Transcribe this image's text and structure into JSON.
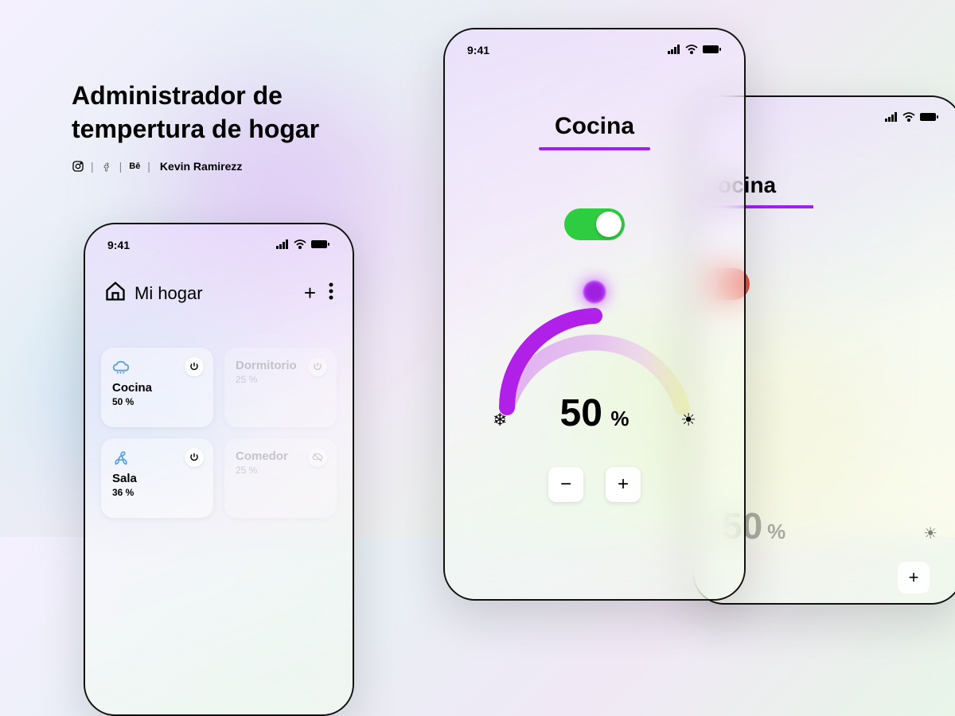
{
  "hero": {
    "title_line1": "Administrador de",
    "title_line2": "tempertura de hogar",
    "author": "Kevin Ramirezz"
  },
  "status": {
    "time": "9:41"
  },
  "phone1": {
    "header_title": "Mi hogar",
    "rooms": [
      {
        "name": "Cocina",
        "percent": "50 %",
        "active": true,
        "icon": "cloud"
      },
      {
        "name": "Dormitorio",
        "percent": "25 %",
        "active": false,
        "icon": "power"
      },
      {
        "name": "Sala",
        "percent": "36 %",
        "active": true,
        "icon": "fan"
      },
      {
        "name": "Comedor",
        "percent": "25 %",
        "active": false,
        "icon": "cloud-off"
      }
    ]
  },
  "phone2": {
    "title": "Cocina",
    "toggle_on": true,
    "value": "50",
    "unit": "%",
    "minus": "−",
    "plus": "+"
  },
  "phone3": {
    "title_suffix": "ocina",
    "toggle_on": false,
    "value": "50",
    "unit": "%",
    "plus": "+"
  },
  "colors": {
    "accent": "#a020f0",
    "toggle_on": "#2ecc40",
    "toggle_off": "#e74c3c"
  }
}
